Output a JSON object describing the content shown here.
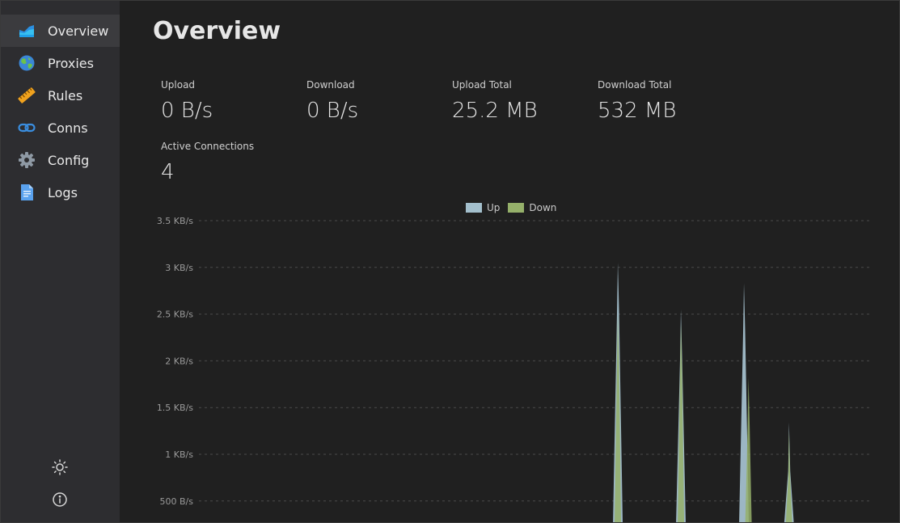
{
  "sidebar": {
    "items": [
      {
        "label": "Overview",
        "icon": "chart-icon",
        "active": true
      },
      {
        "label": "Proxies",
        "icon": "globe-icon",
        "active": false
      },
      {
        "label": "Rules",
        "icon": "ruler-icon",
        "active": false
      },
      {
        "label": "Conns",
        "icon": "link-icon",
        "active": false
      },
      {
        "label": "Config",
        "icon": "gear-icon",
        "active": false
      },
      {
        "label": "Logs",
        "icon": "document-icon",
        "active": false
      }
    ],
    "bottom": [
      {
        "icon": "sun-icon"
      },
      {
        "icon": "info-icon"
      }
    ]
  },
  "main": {
    "title": "Overview",
    "stats": {
      "upload": {
        "label": "Upload",
        "value": "0 B/s"
      },
      "download": {
        "label": "Download",
        "value": "0 B/s"
      },
      "upload_total": {
        "label": "Upload Total",
        "value": "25.2 MB"
      },
      "download_total": {
        "label": "Download Total",
        "value": "532 MB"
      },
      "active_connections": {
        "label": "Active Connections",
        "value": "4"
      }
    }
  },
  "colors": {
    "up": "#a3bfcc",
    "down": "#95b06a",
    "background": "#202020",
    "sidebar": "#2d2d30"
  },
  "chart_data": {
    "type": "area",
    "legend": [
      {
        "name": "Up",
        "color": "#a3bfcc"
      },
      {
        "name": "Down",
        "color": "#95b06a"
      }
    ],
    "legend_position": "top-center",
    "y_ticks": [
      "500 B/s",
      "1 KB/s",
      "1.5 KB/s",
      "2 KB/s",
      "2.5 KB/s",
      "3 KB/s",
      "3.5 KB/s"
    ],
    "y_tick_values": [
      500,
      1000,
      1500,
      2000,
      2500,
      3000,
      3500
    ],
    "ylim": [
      0,
      3500
    ],
    "x_count": 150,
    "series": [
      {
        "name": "Up",
        "points": [
          [
            93,
            3050
          ],
          [
            107,
            2550
          ],
          [
            121,
            2830
          ],
          [
            131,
            1340
          ]
        ]
      },
      {
        "name": "Down",
        "points": [
          [
            93,
            2500
          ],
          [
            107,
            2400
          ],
          [
            122,
            1820
          ],
          [
            131,
            1250
          ]
        ]
      }
    ],
    "grid": true
  }
}
